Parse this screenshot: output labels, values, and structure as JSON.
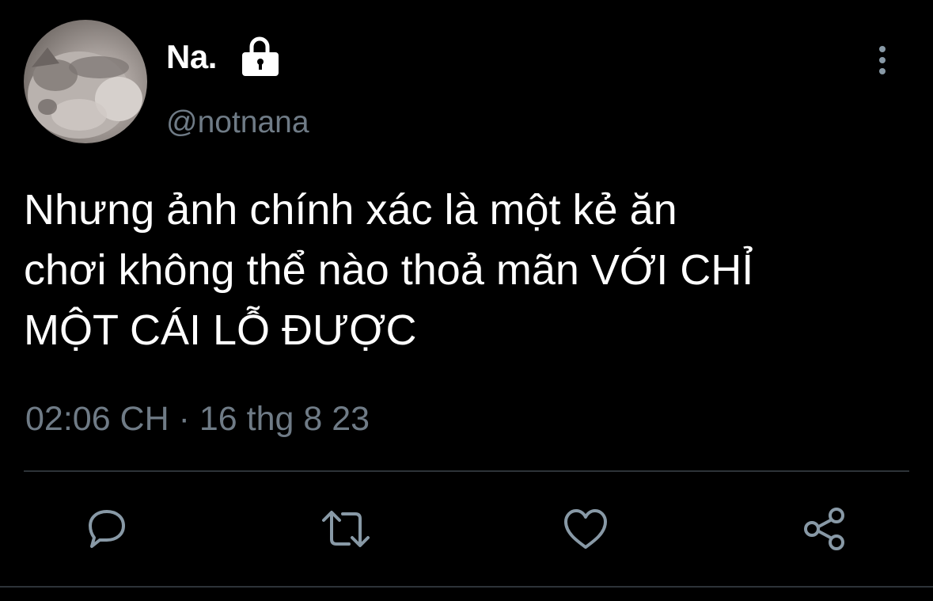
{
  "user": {
    "display_name": "Na.",
    "handle": "@notnana",
    "avatar_icon": "cat-avatar",
    "protected_icon": "lock-icon"
  },
  "tweet": {
    "text": "Nhưng ảnh chính xác là một kẻ ăn\nchơi không thể nào thoả mãn VỚI CHỈ\nMỘT CÁI LỖ ĐƯỢC",
    "meta": "02:06 CH · 16 thg 8 23"
  },
  "actions": {
    "reply_icon": "comment-icon",
    "retweet_icon": "retweet-icon",
    "like_icon": "heart-icon",
    "share_icon": "share-icon"
  },
  "menu_icon": "more-vertical-icon",
  "colors": {
    "background": "#000000",
    "text": "#ffffff",
    "secondary": "#6f7b86",
    "icon": "#8899a6",
    "divider": "#2d3338"
  }
}
